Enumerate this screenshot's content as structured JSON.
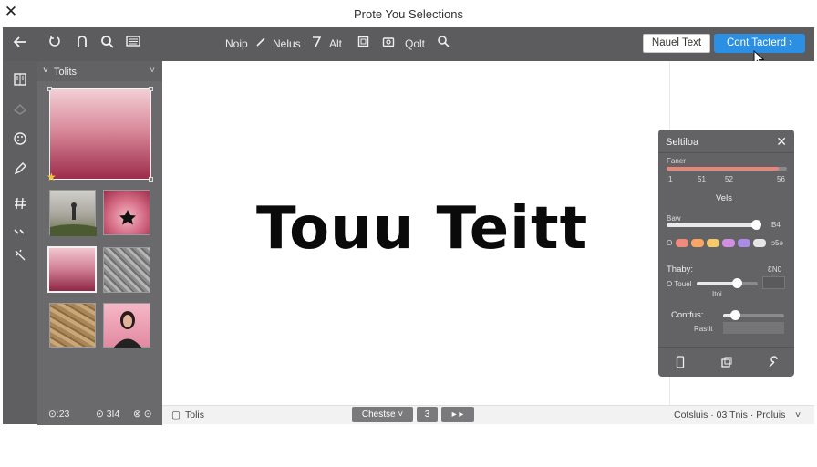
{
  "window": {
    "title": "Prote You Selections",
    "close_glyph": "✕"
  },
  "toolbar": {
    "icons": [
      "back-arrow-icon",
      "loop-icon",
      "arch-icon",
      "zoom-badge-icon",
      "keyboard-icon"
    ],
    "menu": [
      "Noip",
      "Nelus",
      "Alt",
      "Qolt"
    ],
    "next_label": "Nauel Text",
    "primary_label": "Cont Tacterd",
    "primary_caret": "›"
  },
  "assets_panel": {
    "title": "Tolits",
    "caret": "˅",
    "thumbnails": [
      "gradient-large",
      "foggy-person",
      "star-gradient",
      "pink-gradient-selected",
      "grey-texture",
      "desert-texture",
      "portrait"
    ]
  },
  "canvas": {
    "headline": "Touu Teitt"
  },
  "selection_panel": {
    "title": "Seltiloa",
    "close_glyph": "✕",
    "slider1": {
      "label_top": "Faner",
      "ticks": [
        "1",
        "51",
        "52",
        "56"
      ],
      "value": 0.93
    },
    "section_label": "Vels",
    "slider2": {
      "label": "Baw",
      "value_label": "B4",
      "value": 0.97
    },
    "swatch_prefix": "O",
    "swatch_suffix": "ɔ5ə",
    "swatches": [
      "#f08a7c",
      "#f7a665",
      "#f6c96a",
      "#d28ee0",
      "#a88ce6",
      "#e6e6e6"
    ],
    "thaby": {
      "label": "Thaby:",
      "value_label": "ƐN0",
      "option": "O Touel",
      "sub_label": "Itoi",
      "value": 0.71
    },
    "contfus": {
      "label": "Contfus:",
      "sub_label": "Rastit",
      "value": 0.22
    },
    "footer_icons": [
      "phone-icon",
      "copy-icon",
      "brush-icon"
    ]
  },
  "statusbar": {
    "left_items": [
      "⊙:23",
      "⊙ 3I4",
      "⊗ ⊙"
    ],
    "doc_label": "Tolis",
    "dropdown_label": "Chestse",
    "page_number": "3",
    "nav_label": "▸ ▸",
    "right_text": "Cotsluis · 03 Tnis · Proluis"
  }
}
